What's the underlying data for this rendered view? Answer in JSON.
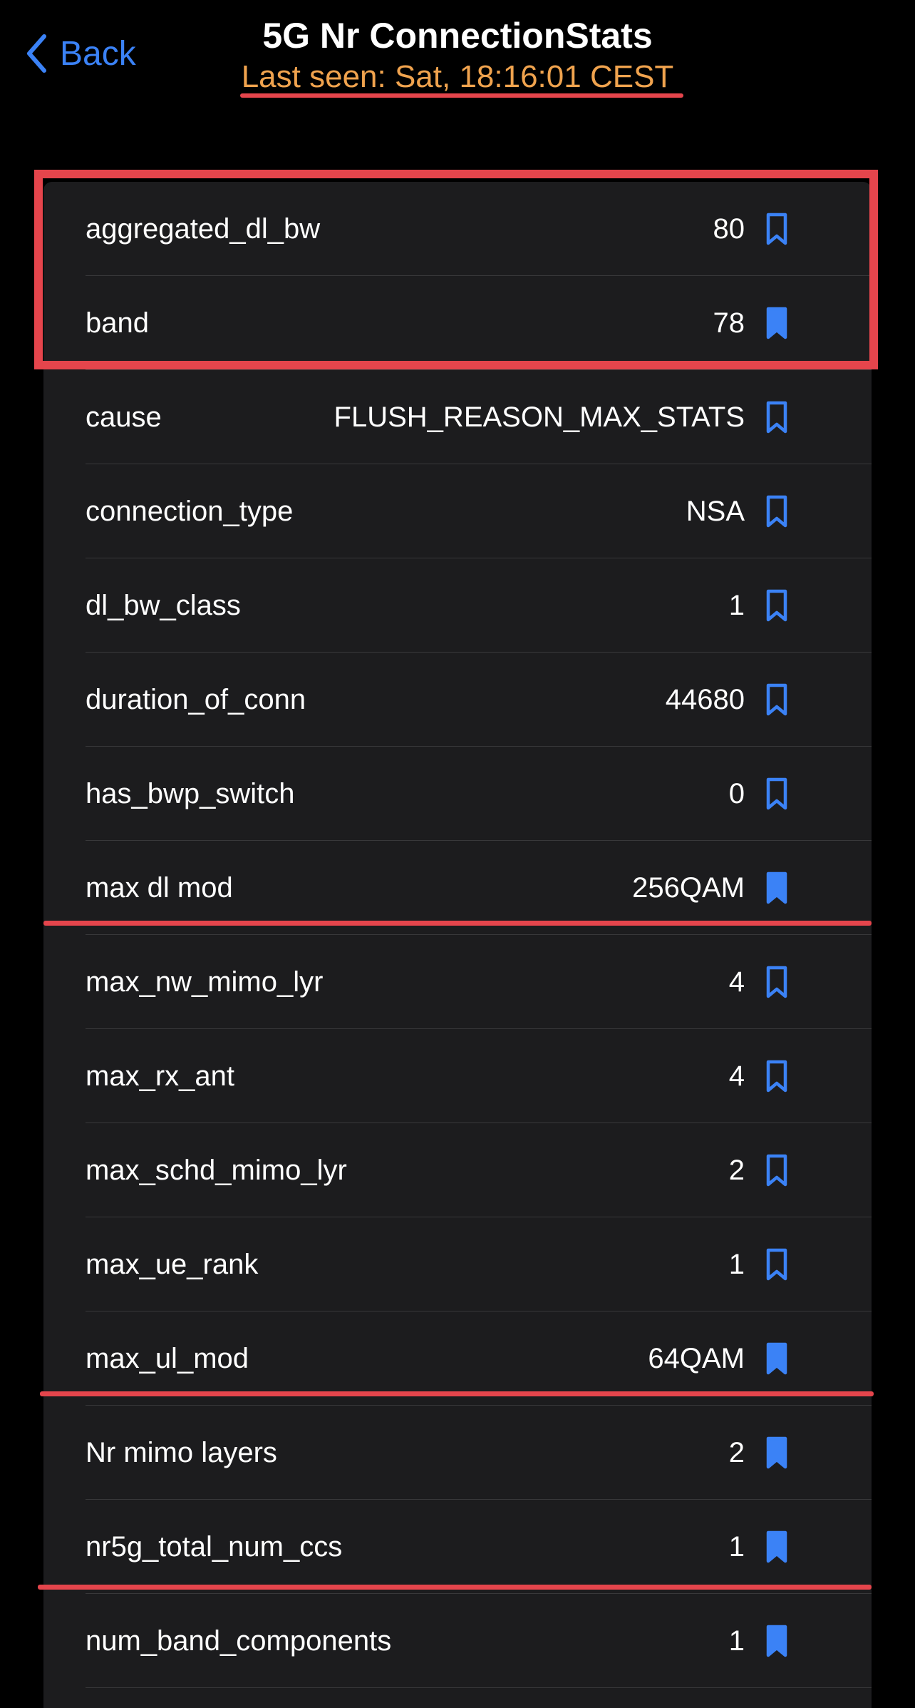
{
  "nav": {
    "back_label": "Back",
    "title": "5G Nr ConnectionStats",
    "subtitle": "Last seen: Sat, 18:16:01 CEST"
  },
  "colors": {
    "background": "#000000",
    "list_background": "#1c1c1e",
    "accent_blue": "#3b82f6",
    "subtitle_orange": "#f0a34e",
    "annotation_red": "#e5454c"
  },
  "rows": [
    {
      "label": "aggregated_dl_bw",
      "value": "80",
      "bookmarked": false
    },
    {
      "label": "band",
      "value": "78",
      "bookmarked": true
    },
    {
      "label": "cause",
      "value": "FLUSH_REASON_MAX_STATS",
      "bookmarked": false
    },
    {
      "label": "connection_type",
      "value": "NSA",
      "bookmarked": false
    },
    {
      "label": "dl_bw_class",
      "value": "1",
      "bookmarked": false
    },
    {
      "label": "duration_of_conn",
      "value": "44680",
      "bookmarked": false
    },
    {
      "label": "has_bwp_switch",
      "value": "0",
      "bookmarked": false
    },
    {
      "label": "max dl mod",
      "value": "256QAM",
      "bookmarked": true
    },
    {
      "label": "max_nw_mimo_lyr",
      "value": "4",
      "bookmarked": false
    },
    {
      "label": "max_rx_ant",
      "value": "4",
      "bookmarked": false
    },
    {
      "label": "max_schd_mimo_lyr",
      "value": "2",
      "bookmarked": false
    },
    {
      "label": "max_ue_rank",
      "value": "1",
      "bookmarked": false
    },
    {
      "label": "max_ul_mod",
      "value": "64QAM",
      "bookmarked": true
    },
    {
      "label": "Nr mimo layers",
      "value": "2",
      "bookmarked": true
    },
    {
      "label": "nr5g_total_num_ccs",
      "value": "1",
      "bookmarked": true
    },
    {
      "label": "num_band_components",
      "value": "1",
      "bookmarked": true
    }
  ]
}
